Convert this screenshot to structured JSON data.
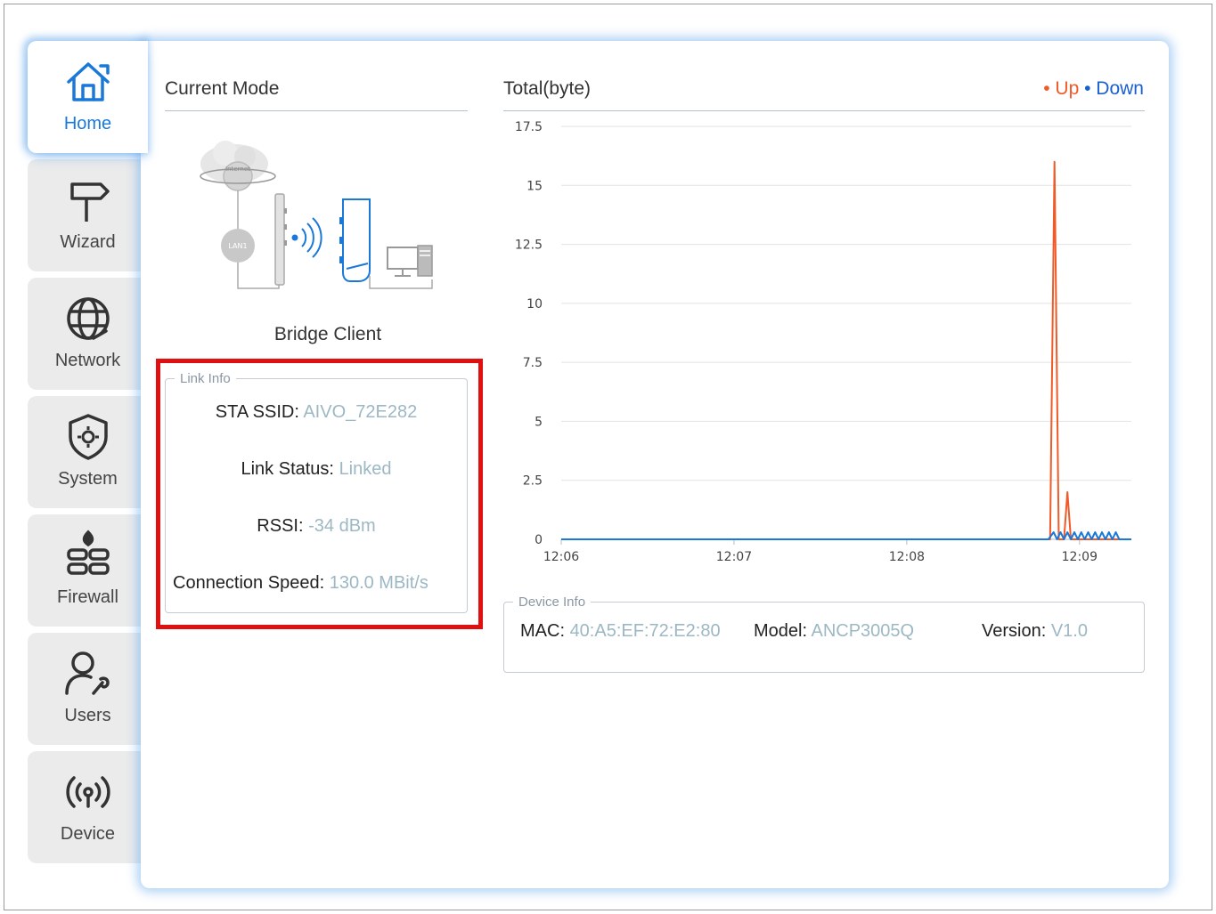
{
  "nav": {
    "items": [
      {
        "label": "Home",
        "icon": "home-icon",
        "active": true
      },
      {
        "label": "Wizard",
        "icon": "signpost-icon",
        "active": false
      },
      {
        "label": "Network",
        "icon": "globe-icon",
        "active": false
      },
      {
        "label": "System",
        "icon": "shield-gear-icon",
        "active": false
      },
      {
        "label": "Firewall",
        "icon": "firewall-icon",
        "active": false
      },
      {
        "label": "Users",
        "icon": "user-wrench-icon",
        "active": false
      },
      {
        "label": "Device",
        "icon": "wireless-icon",
        "active": false
      }
    ]
  },
  "mode": {
    "title": "Current Mode",
    "mode_name": "Bridge Client",
    "diagram_labels": {
      "internet": "Internet",
      "lan": "LAN1"
    }
  },
  "link_info": {
    "legend": "Link Info",
    "ssid_label": "STA SSID:",
    "ssid_value": "AIVO_72E282",
    "status_label": "Link Status:",
    "status_value": "Linked",
    "rssi_label": "RSSI:",
    "rssi_value": "-34 dBm",
    "speed_label": "Connection Speed:",
    "speed_value": "130.0 MBit/s"
  },
  "traffic": {
    "title": "Total(byte)",
    "legend_up": "Up",
    "legend_down": "Down",
    "colors": {
      "up": "#f05a28",
      "down": "#1a78d8"
    }
  },
  "chart_data": {
    "type": "line",
    "title": "Total(byte)",
    "xlabel": "",
    "ylabel": "",
    "ylim": [
      0,
      17.5
    ],
    "xlim": [
      0,
      3.3
    ],
    "yticks": [
      0,
      2.5,
      5,
      7.5,
      10,
      12.5,
      15,
      17.5
    ],
    "xticks": [
      {
        "x": 0,
        "label": "12:06"
      },
      {
        "x": 1,
        "label": "12:07"
      },
      {
        "x": 2,
        "label": "12:08"
      },
      {
        "x": 3,
        "label": "12:09"
      }
    ],
    "grid": true,
    "legend": "top-right",
    "series": [
      {
        "name": "Up",
        "color": "#f05a28",
        "x": [
          0,
          2.83,
          2.855,
          2.88,
          2.91,
          2.93,
          2.95,
          2.97,
          3.3
        ],
        "y": [
          0,
          0,
          16,
          0,
          0,
          2,
          0,
          0,
          0
        ]
      },
      {
        "name": "Down",
        "color": "#1a78d8",
        "x": [
          0,
          2.82,
          2.85,
          2.87,
          2.89,
          2.91,
          2.93,
          2.95,
          2.97,
          2.99,
          3.01,
          3.03,
          3.05,
          3.07,
          3.09,
          3.11,
          3.13,
          3.15,
          3.17,
          3.19,
          3.21,
          3.23,
          3.3
        ],
        "y": [
          0,
          0,
          0.3,
          0,
          0.3,
          0,
          0.3,
          0,
          0.3,
          0,
          0.3,
          0,
          0.3,
          0,
          0.3,
          0,
          0.3,
          0,
          0.3,
          0,
          0.3,
          0,
          0
        ]
      }
    ]
  },
  "device_info": {
    "legend": "Device Info",
    "mac_label": "MAC:",
    "mac_value": "40:A5:EF:72:E2:80",
    "model_label": "Model:",
    "model_value": "ANCP3005Q",
    "version_label": "Version:",
    "version_value": "V1.0"
  }
}
